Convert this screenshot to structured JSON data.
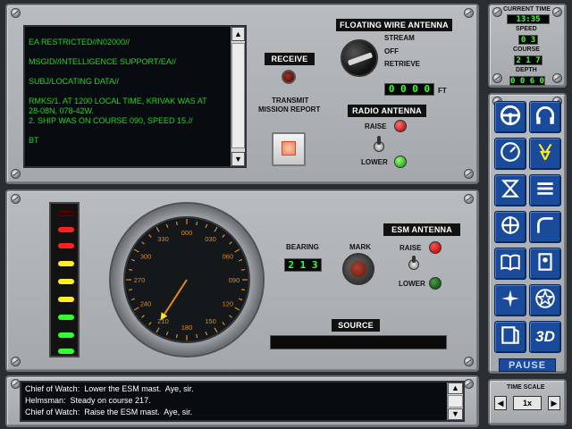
{
  "message_screen": {
    "lines": [
      "EA RESTRICTED//N02000//",
      "",
      "MSGID//INTELLIGENCE SUPPORT/EA//",
      "",
      "SUBJ/LOCATING DATA//",
      "",
      "RMKS/1. AT 1200 LOCAL TIME, KRIVAK WAS AT",
      "28-08N, 078-42W.",
      "2. SHIP WAS ON COURSE 090, SPEED 15.//",
      "",
      "BT"
    ]
  },
  "receive": {
    "label": "RECEIVE"
  },
  "transmit": {
    "label_line1": "TRANSMIT",
    "label_line2": "MISSION REPORT"
  },
  "floating_wire": {
    "title": "FLOATING WIRE ANTENNA",
    "options": [
      "STREAM",
      "OFF",
      "RETRIEVE"
    ],
    "length_value": "0 0 0 0",
    "length_unit": "FT"
  },
  "radio_antenna": {
    "title": "RADIO ANTENNA",
    "raise": "RAISE",
    "lower": "LOWER"
  },
  "status": {
    "current_time_label": "CURRENT TIME",
    "current_time": "13:35",
    "speed_label": "SPEED",
    "speed": "0 3",
    "course_label": "COURSE",
    "course": "2 1 7",
    "depth_label": "DEPTH",
    "depth": "0 0 6 0"
  },
  "compass": {
    "ticks": [
      "000",
      "030",
      "060",
      "090",
      "120",
      "150",
      "180",
      "210",
      "240",
      "270",
      "300",
      "330"
    ],
    "needle_bearing": 213
  },
  "bearing": {
    "label": "BEARING",
    "value": "2 1 3"
  },
  "mark": {
    "label": "MARK"
  },
  "esm_antenna": {
    "title": "ESM ANTENNA",
    "raise": "RAISE",
    "lower": "LOWER"
  },
  "source": {
    "label": "SOURCE",
    "value": ""
  },
  "nav_buttons": [
    {
      "icon": "steering-wheel-icon"
    },
    {
      "icon": "headphones-icon"
    },
    {
      "icon": "gauge-icon"
    },
    {
      "icon": "flash-icon"
    },
    {
      "icon": "hourglass-icon"
    },
    {
      "icon": "list-icon"
    },
    {
      "icon": "crosshair-icon"
    },
    {
      "icon": "curve-icon"
    },
    {
      "icon": "book-icon"
    },
    {
      "icon": "manual-icon"
    },
    {
      "icon": "compass-rose-icon"
    },
    {
      "icon": "star-icon"
    },
    {
      "icon": "door-icon"
    },
    {
      "icon": "3d-icon",
      "text": "3D"
    }
  ],
  "pause": {
    "label": "PAUSE"
  },
  "time_scale": {
    "label": "TIME SCALE",
    "value": "1x"
  },
  "log": {
    "lines": [
      "Chief of Watch:  Lower the ESM mast.  Aye, sir.",
      "Helmsman:  Steady on course 217.",
      "Chief of Watch:  Raise the ESM mast.  Aye, sir."
    ]
  },
  "colors": {
    "screen_text": "#1fd61f",
    "digital_text": "#39ff39",
    "nav_blue": "#1a4a9a",
    "compass_orange": "#e08a1a"
  }
}
